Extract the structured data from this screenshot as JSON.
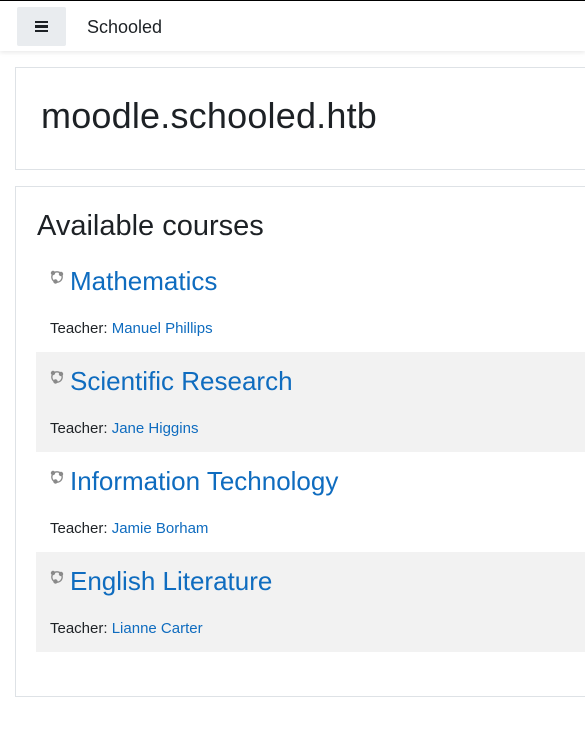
{
  "navbar": {
    "menu_icon": "hamburger-icon",
    "site_name": "Schooled"
  },
  "header": {
    "title": "moodle.schooled.htb"
  },
  "courses": {
    "heading": "Available courses",
    "teacher_label": "Teacher:",
    "course_icon": "course-icon",
    "link_color": "#0f6cbf",
    "items": [
      {
        "name": "Mathematics",
        "teacher": "Manuel Phillips"
      },
      {
        "name": "Scientific Research",
        "teacher": "Jane Higgins"
      },
      {
        "name": "Information Technology",
        "teacher": "Jamie Borham"
      },
      {
        "name": "English Literature",
        "teacher": "Lianne Carter"
      }
    ]
  }
}
